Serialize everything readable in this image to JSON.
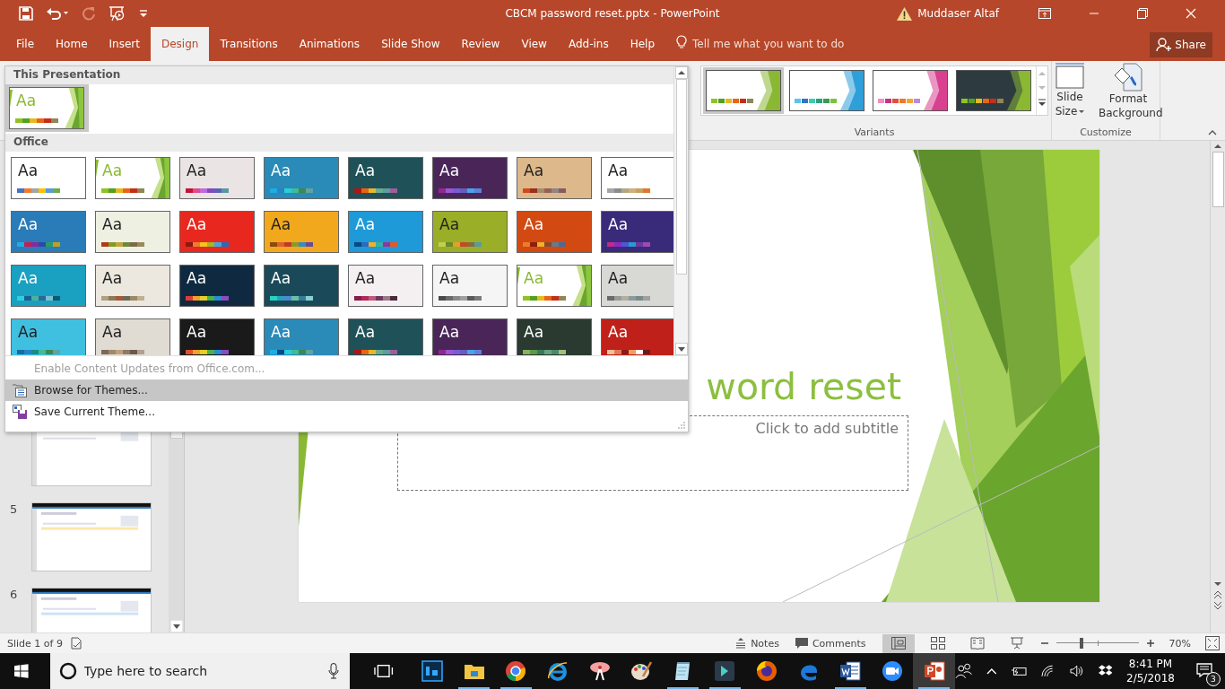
{
  "window": {
    "title": "CBCM password reset.pptx  -  PowerPoint",
    "user": "Muddaser Altaf"
  },
  "tabs": [
    {
      "label": "File",
      "selected": false
    },
    {
      "label": "Home",
      "selected": false
    },
    {
      "label": "Insert",
      "selected": false
    },
    {
      "label": "Design",
      "selected": true
    },
    {
      "label": "Transitions",
      "selected": false
    },
    {
      "label": "Animations",
      "selected": false
    },
    {
      "label": "Slide Show",
      "selected": false
    },
    {
      "label": "Review",
      "selected": false
    },
    {
      "label": "View",
      "selected": false
    },
    {
      "label": "Add-ins",
      "selected": false
    },
    {
      "label": "Help",
      "selected": false
    }
  ],
  "tell_me": {
    "placeholder": "Tell me what you want to do"
  },
  "share": "Share",
  "variants": {
    "label": "Variants",
    "items": [
      {
        "selected": true,
        "dark": false,
        "color": "#8ab833",
        "swatches": [
          {
            "color": "#90c226"
          },
          {
            "color": "#54a021"
          },
          {
            "color": "#e6b91e"
          },
          {
            "color": "#e76618"
          },
          {
            "color": "#c42f1a"
          },
          {
            "color": "#918655"
          }
        ]
      },
      {
        "selected": false,
        "dark": false,
        "color": "#2e9fd8",
        "swatches": [
          {
            "color": "#5ac4ec"
          },
          {
            "color": "#2f77c4"
          },
          {
            "color": "#3acdb4"
          },
          {
            "color": "#2aa07a"
          },
          {
            "color": "#3b9a54"
          },
          {
            "color": "#7cc23a"
          }
        ]
      },
      {
        "selected": false,
        "dark": false,
        "color": "#d9408f",
        "swatches": [
          {
            "color": "#f28cc4"
          },
          {
            "color": "#c4377c"
          },
          {
            "color": "#e0503a"
          },
          {
            "color": "#f0782a"
          },
          {
            "color": "#f0a92e"
          },
          {
            "color": "#b98ae0"
          }
        ]
      },
      {
        "selected": false,
        "dark": true,
        "color": "#8ab833",
        "swatches": [
          {
            "color": "#90c226"
          },
          {
            "color": "#54a021"
          },
          {
            "color": "#e6b91e"
          },
          {
            "color": "#e76618"
          },
          {
            "color": "#c42f1a"
          },
          {
            "color": "#918655"
          }
        ]
      }
    ]
  },
  "customize": {
    "label": "Customize",
    "buttons": [
      {
        "label": "Slide Size",
        "kind": "size"
      },
      {
        "label": "Format Background",
        "kind": "background"
      }
    ]
  },
  "theme_menu": {
    "sections": [
      {
        "heading": "This Presentation",
        "themes": [
          {
            "label": "Aa",
            "kind": "facet",
            "color": "#ffffff",
            "selected": true,
            "swatches": [
              {
                "color": "#90c226"
              },
              {
                "color": "#54a021"
              },
              {
                "color": "#e6b91e"
              },
              {
                "color": "#e76618"
              },
              {
                "color": "#c42f1a"
              },
              {
                "color": "#918655"
              }
            ]
          }
        ]
      },
      {
        "heading": "Office",
        "themes": [
          {
            "label": "Aa",
            "kind": "plain",
            "color": "#ffffff",
            "selected": false,
            "swatches": [
              {
                "color": "#4472c4"
              },
              {
                "color": "#ed7d31"
              },
              {
                "color": "#a5a5a5"
              },
              {
                "color": "#ffc000"
              },
              {
                "color": "#5b9bd5"
              },
              {
                "color": "#70ad47"
              }
            ]
          },
          {
            "label": "Aa",
            "kind": "facet",
            "color": "#ffffff",
            "selected": false,
            "swatches": [
              {
                "color": "#90c226"
              },
              {
                "color": "#54a021"
              },
              {
                "color": "#e6b91e"
              },
              {
                "color": "#e76618"
              },
              {
                "color": "#c42f1a"
              },
              {
                "color": "#918655"
              }
            ]
          },
          {
            "label": "Aa",
            "kind": "plain",
            "color": "#ebe4e4",
            "selected": false,
            "swatches": [
              {
                "color": "#c0143c"
              },
              {
                "color": "#e24b8a"
              },
              {
                "color": "#be6ae0"
              },
              {
                "color": "#8549ba"
              },
              {
                "color": "#5b63b8"
              },
              {
                "color": "#5a98a1"
              }
            ]
          },
          {
            "label": "Aa",
            "kind": "plain",
            "color": "#2a8ab8",
            "selected": false,
            "swatches": [
              {
                "color": "#1cade4"
              },
              {
                "color": "#2683c6"
              },
              {
                "color": "#27ced7"
              },
              {
                "color": "#42ba97"
              },
              {
                "color": "#3e8853"
              },
              {
                "color": "#62a39f"
              }
            ]
          },
          {
            "label": "Aa",
            "kind": "plain",
            "color": "#1f5258",
            "selected": false,
            "swatches": [
              {
                "color": "#b01513"
              },
              {
                "color": "#ea6312"
              },
              {
                "color": "#e6b729"
              },
              {
                "color": "#6aac90"
              },
              {
                "color": "#5f9c9d"
              },
              {
                "color": "#9e5e9b"
              }
            ]
          },
          {
            "label": "Aa",
            "kind": "plain",
            "color": "#4a2658",
            "selected": false,
            "swatches": [
              {
                "color": "#92278f"
              },
              {
                "color": "#9b57d3"
              },
              {
                "color": "#755dd9"
              },
              {
                "color": "#665eb8"
              },
              {
                "color": "#45a5ed"
              },
              {
                "color": "#5982db"
              }
            ]
          },
          {
            "label": "Aa",
            "kind": "plain",
            "color": "#dcb88a",
            "selected": false,
            "swatches": [
              {
                "color": "#d34817"
              },
              {
                "color": "#9b2d1f"
              },
              {
                "color": "#a28e6a"
              },
              {
                "color": "#956251"
              },
              {
                "color": "#918485"
              },
              {
                "color": "#855d5d"
              }
            ]
          },
          {
            "label": "Aa",
            "kind": "plain",
            "color": "#ffffff",
            "selected": false,
            "swatches": [
              {
                "color": "#a5a5a5"
              },
              {
                "color": "#8c8c8c"
              },
              {
                "color": "#b0a888"
              },
              {
                "color": "#d0b078"
              },
              {
                "color": "#c8a060"
              },
              {
                "color": "#e0782a"
              }
            ]
          },
          {
            "label": "Aa",
            "kind": "plain",
            "color": "#2a7cb8",
            "selected": false,
            "swatches": [
              {
                "color": "#1cade4"
              },
              {
                "color": "#c01f5a"
              },
              {
                "color": "#8a2a9a"
              },
              {
                "color": "#2a4aa8"
              },
              {
                "color": "#2a9a6a"
              },
              {
                "color": "#c0a020"
              }
            ]
          },
          {
            "label": "Aa",
            "kind": "plain",
            "color": "#eef0e2",
            "selected": false,
            "swatches": [
              {
                "color": "#b03a1a"
              },
              {
                "color": "#83992a"
              },
              {
                "color": "#c0a53a"
              },
              {
                "color": "#6a8a3a"
              },
              {
                "color": "#7a6a4a"
              },
              {
                "color": "#9a8a5a"
              }
            ]
          },
          {
            "label": "Aa",
            "kind": "plain",
            "color": "#e8281e",
            "selected": false,
            "swatches": [
              {
                "color": "#8a1a12"
              },
              {
                "color": "#f07a2e"
              },
              {
                "color": "#f0c81d"
              },
              {
                "color": "#a8b42a"
              },
              {
                "color": "#4aa3d8"
              },
              {
                "color": "#2a6ab8"
              }
            ]
          },
          {
            "label": "Aa",
            "kind": "plain",
            "color": "#f2a81d",
            "selected": false,
            "swatches": [
              {
                "color": "#8a4a10"
              },
              {
                "color": "#e0602a"
              },
              {
                "color": "#c03a2a"
              },
              {
                "color": "#8a9a2a"
              },
              {
                "color": "#3a8ac0"
              },
              {
                "color": "#6a4a9a"
              }
            ]
          },
          {
            "label": "Aa",
            "kind": "plain",
            "color": "#1e9ad8",
            "selected": false,
            "swatches": [
              {
                "color": "#0a4a80"
              },
              {
                "color": "#2a6ac0"
              },
              {
                "color": "#f0b02a"
              },
              {
                "color": "#3ab0a0"
              },
              {
                "color": "#8a3a9a"
              },
              {
                "color": "#e05a2a"
              }
            ]
          },
          {
            "label": "Aa",
            "kind": "plain",
            "color": "#9aae27",
            "selected": false,
            "swatches": [
              {
                "color": "#c0d050"
              },
              {
                "color": "#6a8a2a"
              },
              {
                "color": "#e0a02a"
              },
              {
                "color": "#c04a2a"
              },
              {
                "color": "#8a6a3a"
              },
              {
                "color": "#5a9aa0"
              }
            ]
          },
          {
            "label": "Aa",
            "kind": "plain",
            "color": "#d24a12",
            "selected": false,
            "swatches": [
              {
                "color": "#f07a2a"
              },
              {
                "color": "#8a200a"
              },
              {
                "color": "#f0b02a"
              },
              {
                "color": "#8a4a2a"
              },
              {
                "color": "#6a7a8a"
              },
              {
                "color": "#4a6a9a"
              }
            ]
          },
          {
            "label": "Aa",
            "kind": "plain",
            "color": "#3a2a7a",
            "selected": false,
            "swatches": [
              {
                "color": "#c02a8a"
              },
              {
                "color": "#8a2ac0"
              },
              {
                "color": "#4a5ad0"
              },
              {
                "color": "#2a9ad0"
              },
              {
                "color": "#6a3aa0"
              },
              {
                "color": "#a04ab0"
              }
            ]
          },
          {
            "label": "Aa",
            "kind": "plain",
            "color": "#1aa0c0",
            "selected": false,
            "swatches": [
              {
                "color": "#2ad0e0"
              },
              {
                "color": "#1a6090"
              },
              {
                "color": "#4ab0a0"
              },
              {
                "color": "#2a6a9a"
              },
              {
                "color": "#7ac0d0"
              },
              {
                "color": "#0a5a70"
              }
            ]
          },
          {
            "label": "Aa",
            "kind": "plain",
            "color": "#ece8e0",
            "selected": false,
            "swatches": [
              {
                "color": "#b0a080"
              },
              {
                "color": "#8a7a5a"
              },
              {
                "color": "#a05a3a"
              },
              {
                "color": "#6a6a5a"
              },
              {
                "color": "#9a8a6a"
              },
              {
                "color": "#c0b090"
              }
            ]
          },
          {
            "label": "Aa",
            "kind": "plain",
            "color": "#0f2a40",
            "selected": false,
            "swatches": [
              {
                "color": "#e03a3a"
              },
              {
                "color": "#f0a02a"
              },
              {
                "color": "#e0d02a"
              },
              {
                "color": "#4ab04a"
              },
              {
                "color": "#2a8ad0"
              },
              {
                "color": "#8a4ac0"
              }
            ]
          },
          {
            "label": "Aa",
            "kind": "plain",
            "color": "#1a4a5a",
            "selected": false,
            "swatches": [
              {
                "color": "#2ad0c0"
              },
              {
                "color": "#2aa0c0"
              },
              {
                "color": "#4a8ad0"
              },
              {
                "color": "#6ac0a0"
              },
              {
                "color": "#3a7a9a"
              },
              {
                "color": "#8ad0d0"
              }
            ]
          },
          {
            "label": "Aa",
            "kind": "plain",
            "color": "#f4f0f2",
            "selected": false,
            "swatches": [
              {
                "color": "#8a1a4a"
              },
              {
                "color": "#b02a5a"
              },
              {
                "color": "#c05a7a"
              },
              {
                "color": "#6a3a5a"
              },
              {
                "color": "#9a7a8a"
              },
              {
                "color": "#4a2a3a"
              }
            ]
          },
          {
            "label": "Aa",
            "kind": "plain",
            "color": "#f5f5f5",
            "selected": false,
            "swatches": [
              {
                "color": "#4a4a4a"
              },
              {
                "color": "#6a6a6a"
              },
              {
                "color": "#8a8a8a"
              },
              {
                "color": "#a0a0a0"
              },
              {
                "color": "#5a5a5a"
              },
              {
                "color": "#7a7a7a"
              }
            ]
          },
          {
            "label": "Aa",
            "kind": "facet",
            "color": "#ffffff",
            "selected": false,
            "swatches": [
              {
                "color": "#90c226"
              },
              {
                "color": "#54a021"
              },
              {
                "color": "#e6b91e"
              },
              {
                "color": "#e76618"
              },
              {
                "color": "#c42f1a"
              },
              {
                "color": "#918655"
              }
            ]
          },
          {
            "label": "Aa",
            "kind": "plain",
            "color": "#d8d8d4",
            "selected": false,
            "swatches": [
              {
                "color": "#6a6a6a"
              },
              {
                "color": "#9a9a9a"
              },
              {
                "color": "#b0b0a0"
              },
              {
                "color": "#8a9aa0"
              },
              {
                "color": "#7a8a8a"
              },
              {
                "color": "#a0a0a0"
              }
            ]
          },
          {
            "label": "Aa",
            "kind": "plain",
            "color": "#40c0e0",
            "selected": false,
            "swatches": [
              {
                "color": "#1a6aa4"
              },
              {
                "color": "#2683c6"
              },
              {
                "color": "#1a8a8a"
              },
              {
                "color": "#42ba97"
              },
              {
                "color": "#3e8853"
              },
              {
                "color": "#62a39f"
              }
            ]
          },
          {
            "label": "Aa",
            "kind": "plain",
            "color": "#e0dcd4",
            "selected": false,
            "swatches": [
              {
                "color": "#7a6a5a"
              },
              {
                "color": "#a08a6a"
              },
              {
                "color": "#c0a080"
              },
              {
                "color": "#8a7a6a"
              },
              {
                "color": "#6a5a4a"
              },
              {
                "color": "#b0a090"
              }
            ]
          },
          {
            "label": "Aa",
            "kind": "plain",
            "color": "#1a1a1a",
            "selected": false,
            "swatches": [
              {
                "color": "#e0502a"
              },
              {
                "color": "#f0a02a"
              },
              {
                "color": "#e0d02a"
              },
              {
                "color": "#4ab04a"
              },
              {
                "color": "#2a8ad0"
              },
              {
                "color": "#8a4ac0"
              }
            ]
          },
          {
            "label": "Aa",
            "kind": "plain",
            "color": "#2a8ab8",
            "selected": false,
            "swatches": [
              {
                "color": "#1cade4"
              },
              {
                "color": "#0a4a86"
              },
              {
                "color": "#27ced7"
              },
              {
                "color": "#42ba97"
              },
              {
                "color": "#3e8853"
              },
              {
                "color": "#62a39f"
              }
            ]
          },
          {
            "label": "Aa",
            "kind": "plain",
            "color": "#1f5258",
            "selected": false,
            "swatches": [
              {
                "color": "#b01513"
              },
              {
                "color": "#ea6312"
              },
              {
                "color": "#e6b729"
              },
              {
                "color": "#6aac90"
              },
              {
                "color": "#5f9c9d"
              },
              {
                "color": "#9e5e9b"
              }
            ]
          },
          {
            "label": "Aa",
            "kind": "plain",
            "color": "#4a2658",
            "selected": false,
            "swatches": [
              {
                "color": "#92278f"
              },
              {
                "color": "#9b57d3"
              },
              {
                "color": "#755dd9"
              },
              {
                "color": "#665eb8"
              },
              {
                "color": "#45a5ed"
              },
              {
                "color": "#5982db"
              }
            ]
          },
          {
            "label": "Aa",
            "kind": "plain",
            "color": "#2a3a30",
            "selected": false,
            "swatches": [
              {
                "color": "#8ab060"
              },
              {
                "color": "#5a9a4a"
              },
              {
                "color": "#3a7a5a"
              },
              {
                "color": "#6aa080"
              },
              {
                "color": "#4a8a6a"
              },
              {
                "color": "#a0c080"
              }
            ]
          },
          {
            "label": "Aa",
            "kind": "plain",
            "color": "#c0201a",
            "selected": false,
            "swatches": [
              {
                "color": "#f0c0a0"
              },
              {
                "color": "#e07a5a"
              },
              {
                "color": "#8a1a1a"
              },
              {
                "color": "#f0a05a"
              },
              {
                "color": "#ffffff"
              },
              {
                "color": "#6a1a1a"
              }
            ]
          }
        ]
      }
    ],
    "actions": [
      {
        "label": "Enable Content Updates from Office.com...",
        "disabled": true,
        "highlighted": false,
        "kind": "none"
      },
      {
        "label": "Browse for Themes...",
        "disabled": false,
        "highlighted": true,
        "kind": "browse"
      },
      {
        "label": "Save Current Theme...",
        "disabled": false,
        "highlighted": false,
        "kind": "save"
      }
    ]
  },
  "slides_pane": {
    "slides": [
      {
        "selected": false
      },
      {
        "number": "5",
        "selected": false
      },
      {
        "number": "6",
        "selected": false
      }
    ]
  },
  "slide": {
    "title": "word reset",
    "subtitle_placeholder": "Click to add subtitle"
  },
  "status_bar": {
    "slide_counter": "Slide 1 of 9",
    "notes": "Notes",
    "comments": "Comments",
    "views": [
      {
        "kind": "normal",
        "selected": true
      },
      {
        "kind": "sorter",
        "selected": false
      },
      {
        "kind": "reading",
        "selected": false
      },
      {
        "kind": "show",
        "selected": false
      }
    ],
    "zoom": {
      "level": 0.31,
      "reading": "70%"
    }
  },
  "taskbar": {
    "search": {
      "placeholder": "Type here to search"
    },
    "apps": [
      {
        "kind": "photoshop",
        "running": false,
        "selected": false
      },
      {
        "kind": "explorer",
        "running": true,
        "selected": false
      },
      {
        "kind": "chrome",
        "running": true,
        "selected": false
      },
      {
        "kind": "ie",
        "running": false,
        "selected": false
      },
      {
        "kind": "snip",
        "running": false,
        "selected": false
      },
      {
        "kind": "paint",
        "running": false,
        "selected": false
      },
      {
        "kind": "notepad",
        "running": true,
        "selected": false
      },
      {
        "kind": "filmora",
        "running": true,
        "selected": false
      },
      {
        "kind": "firefox",
        "running": false,
        "selected": false
      },
      {
        "kind": "edge",
        "running": false,
        "selected": false
      },
      {
        "kind": "word",
        "running": true,
        "selected": false
      },
      {
        "kind": "zoom",
        "running": false,
        "selected": false
      },
      {
        "kind": "powerpoint",
        "running": true,
        "selected": true
      }
    ],
    "time": "8:41 PM",
    "date": "2/5/2018",
    "notifications": "3"
  }
}
